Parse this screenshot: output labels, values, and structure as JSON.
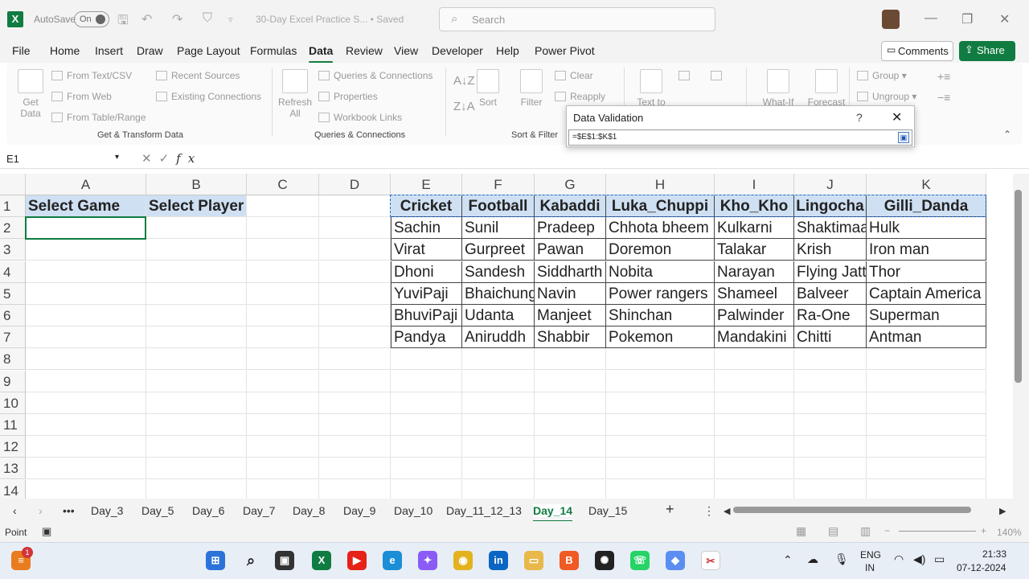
{
  "titlebar": {
    "autosave_label": "AutoSave",
    "autosave_state": "On",
    "doc_title": "30-Day Excel Practice S...  • Saved",
    "search_placeholder": "Search"
  },
  "tabs": [
    "File",
    "Home",
    "Insert",
    "Draw",
    "Page Layout",
    "Formulas",
    "Data",
    "Review",
    "View",
    "Developer",
    "Help",
    "Power Pivot"
  ],
  "active_tab": "Data",
  "buttons": {
    "comments": "Comments",
    "share": "Share"
  },
  "ribbon": {
    "get_data": "Get\nData",
    "from_text_csv": "From Text/CSV",
    "from_web": "From Web",
    "from_table_range": "From Table/Range",
    "recent_sources": "Recent Sources",
    "existing_connections": "Existing Connections",
    "group_get_transform": "Get & Transform Data",
    "refresh_all": "Refresh\nAll",
    "queries_connections": "Queries & Connections",
    "properties": "Properties",
    "workbook_links": "Workbook Links",
    "group_queries": "Queries & Connections",
    "sort": "Sort",
    "filter": "Filter",
    "clear": "Clear",
    "reapply": "Reapply",
    "group_sort_filter": "Sort & Filter",
    "text_to": "Text to",
    "what_if": "What-If",
    "forecast": "Forecast",
    "group": "Group",
    "ungroup": "Ungroup"
  },
  "formula_bar": {
    "name_box": "E1",
    "fx": "fx"
  },
  "dialog": {
    "title": "Data Validation",
    "help": "?",
    "close": "✕",
    "input": "=$E$1:$K$1"
  },
  "columns": [
    "A",
    "B",
    "C",
    "D",
    "E",
    "F",
    "G",
    "H",
    "I",
    "J",
    "K"
  ],
  "rows": [
    "1",
    "2",
    "3",
    "4",
    "5",
    "6",
    "7",
    "8",
    "9",
    "10",
    "11",
    "12",
    "13",
    "14"
  ],
  "left_headers": [
    "Select Game",
    "Select Player"
  ],
  "table": {
    "headers": [
      "Cricket",
      "Football",
      "Kabaddi",
      "Luka_Chuppi",
      "Kho_Kho",
      "Lingocha",
      "Gilli_Danda"
    ],
    "rows": [
      [
        "Sachin",
        "Sunil",
        "Pradeep",
        "Chhota bheem",
        "Kulkarni",
        "Shaktimaan",
        "Hulk"
      ],
      [
        "Virat",
        "Gurpreet",
        "Pawan",
        "Doremon",
        "Talakar",
        "Krish",
        "Iron man"
      ],
      [
        "Dhoni",
        "Sandesh",
        "Siddharth",
        "Nobita",
        "Narayan",
        "Flying Jatt",
        "Thor"
      ],
      [
        "YuviPaji",
        "Bhaichung",
        "Navin",
        "Power rangers",
        "Shameel",
        "Balveer",
        "Captain America"
      ],
      [
        "BhuviPaji",
        "Udanta",
        "Manjeet",
        "Shinchan",
        "Palwinder",
        "Ra-One",
        "Superman"
      ],
      [
        "Pandya",
        "Aniruddh",
        "Shabbir",
        "Pokemon",
        "Mandakini",
        "Chitti",
        "Antman"
      ]
    ]
  },
  "sheets": [
    "Day_3",
    "Day_5",
    "Day_6",
    "Day_7",
    "Day_8",
    "Day_9",
    "Day_10",
    "Day_11_12_13",
    "Day_14",
    "Day_15"
  ],
  "active_sheet": "Day_14",
  "status": {
    "mode": "Point",
    "zoom": "140%"
  },
  "taskbar": {
    "lang1": "ENG",
    "lang2": "IN",
    "time": "21:33",
    "date": "07-12-2024",
    "badge": "1"
  },
  "colors": {
    "excel_green": "#107c41",
    "header_fill": "#cfe0f3"
  }
}
